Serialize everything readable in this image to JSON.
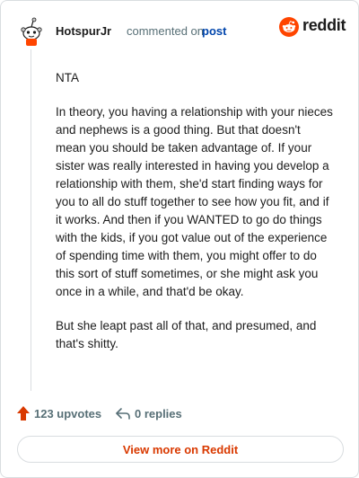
{
  "header": {
    "username": "HotspurJr",
    "commented_text": "commented on",
    "post_link": "post",
    "brand_word": "reddit",
    "brand_color": "#ff4500"
  },
  "comment": {
    "paragraphs": [
      "NTA",
      "In theory, you having a relationship with your nieces and nephews is a good thing. But that doesn't mean you should be taken advantage of. If your sister was really interested in having you develop a relationship with them, she'd start finding ways for you to all do stuff together to see how you fit, and if it works. And then if you WANTED to go do things with the kids, if you got value out of the experience of spending time with them, you might offer to do this sort of stuff sometimes, or she might ask you once in a while, and that'd be okay.",
      "But she leapt past all of that, and presumed, and that's shitty."
    ]
  },
  "actions": {
    "upvotes": "123 upvotes",
    "replies": "0 replies",
    "upvote_icon": "upvote-arrow-icon",
    "reply_icon": "reply-arrow-icon"
  },
  "footer": {
    "view_more": "View more on Reddit",
    "accent": "#d93900"
  }
}
